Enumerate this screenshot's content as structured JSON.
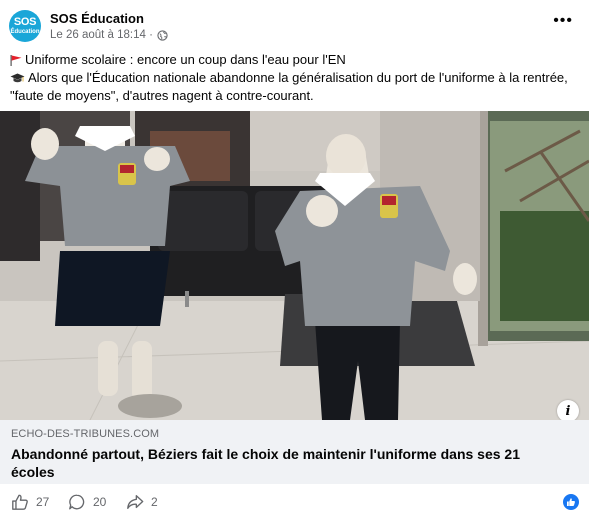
{
  "post": {
    "page_name": "SOS Éducation",
    "avatar_text_1": "SOS",
    "avatar_text_2": "Éducation",
    "timestamp": "Le 26 août à 18:14 ·",
    "audience_icon": "globe-icon",
    "more_label": "•••",
    "text_lines": [
      "Uniforme scolaire : encore un coup dans l'eau pour l'EN",
      "Alors que l'Éducation nationale abandonne la généralisation du port de l'uniforme à la rentrée,",
      "\"faute de moyens\", d'autres nagent à contre-courant."
    ]
  },
  "link_preview": {
    "domain": "ECHO-DES-TRIBUNES.COM",
    "title": "Abandonné partout, Béziers fait le choix de maintenir l'uniforme dans ses 21 écoles",
    "info_label": "i"
  },
  "actions": {
    "likes": "27",
    "comments": "20",
    "shares": "2"
  },
  "colors": {
    "brand_blue": "#1aa6d8",
    "facebook_blue": "#1877f2",
    "secondary_text": "#65676b",
    "link_box_bg": "#f0f2f5"
  }
}
